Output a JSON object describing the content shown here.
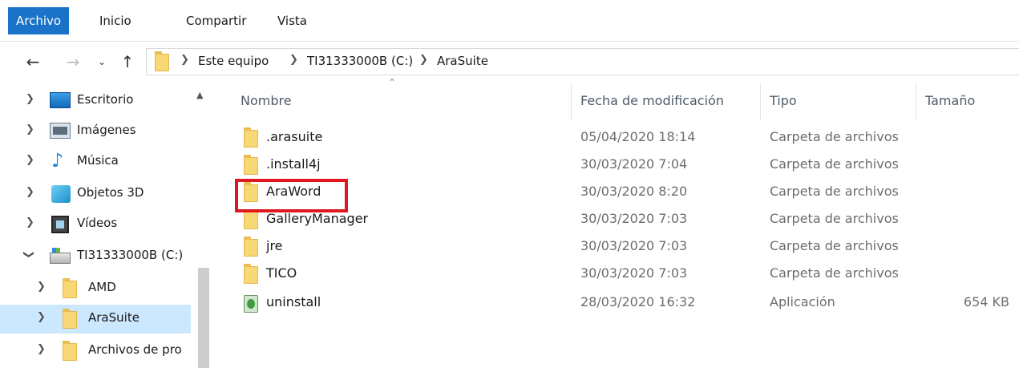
{
  "ribbon": {
    "tabs": [
      {
        "label": "Archivo",
        "active": true
      },
      {
        "label": "Inicio",
        "active": false
      },
      {
        "label": "Compartir",
        "active": false
      },
      {
        "label": "Vista",
        "active": false
      }
    ]
  },
  "toolbar": {
    "back_icon": "back-arrow-icon",
    "forward_icon": "forward-arrow-icon",
    "recent_icon": "chevron-down-icon",
    "up_icon": "up-arrow-icon"
  },
  "address": {
    "breadcrumbs": [
      "Este equipo",
      "TI31333000B (C:)",
      "AraSuite"
    ]
  },
  "navpane": {
    "items": [
      {
        "label": "Escritorio",
        "icon": "desktop-icon",
        "expanded": false
      },
      {
        "label": "Imágenes",
        "icon": "images-icon",
        "expanded": false
      },
      {
        "label": "Música",
        "icon": "music-icon",
        "expanded": false
      },
      {
        "label": "Objetos 3D",
        "icon": "3d-objects-icon",
        "expanded": false
      },
      {
        "label": "Vídeos",
        "icon": "videos-icon",
        "expanded": false
      },
      {
        "label": "TI31333000B (C:)",
        "icon": "drive-icon",
        "expanded": true
      },
      {
        "label": "AMD",
        "icon": "folder-icon",
        "expanded": false
      },
      {
        "label": "AraSuite",
        "icon": "folder-icon",
        "expanded": false,
        "selected": true
      },
      {
        "label": "Archivos de pro",
        "icon": "folder-icon",
        "expanded": false
      }
    ]
  },
  "filelist": {
    "headers": {
      "name": "Nombre",
      "date": "Fecha de modificación",
      "type": "Tipo",
      "size": "Tamaño"
    },
    "rows": [
      {
        "name": ".arasuite",
        "date": "05/04/2020 18:14",
        "type": "Carpeta de archivos",
        "size": "",
        "icon": "folder-icon"
      },
      {
        "name": ".install4j",
        "date": "30/03/2020 7:04",
        "type": "Carpeta de archivos",
        "size": "",
        "icon": "folder-icon"
      },
      {
        "name": "AraWord",
        "date": "30/03/2020 8:20",
        "type": "Carpeta de archivos",
        "size": "",
        "icon": "folder-icon",
        "highlighted": true
      },
      {
        "name": "GalleryManager",
        "date": "30/03/2020 7:03",
        "type": "Carpeta de archivos",
        "size": "",
        "icon": "folder-icon"
      },
      {
        "name": "jre",
        "date": "30/03/2020 7:03",
        "type": "Carpeta de archivos",
        "size": "",
        "icon": "folder-icon"
      },
      {
        "name": "TICO",
        "date": "30/03/2020 7:03",
        "type": "Carpeta de archivos",
        "size": "",
        "icon": "folder-icon"
      },
      {
        "name": "uninstall",
        "date": "28/03/2020 16:32",
        "type": "Aplicación",
        "size": "654 KB",
        "icon": "application-icon"
      }
    ]
  },
  "colors": {
    "accent": "#1a73c8",
    "selection": "#cce8ff",
    "highlight_box": "#e0171f",
    "folder": "#f8d775"
  }
}
